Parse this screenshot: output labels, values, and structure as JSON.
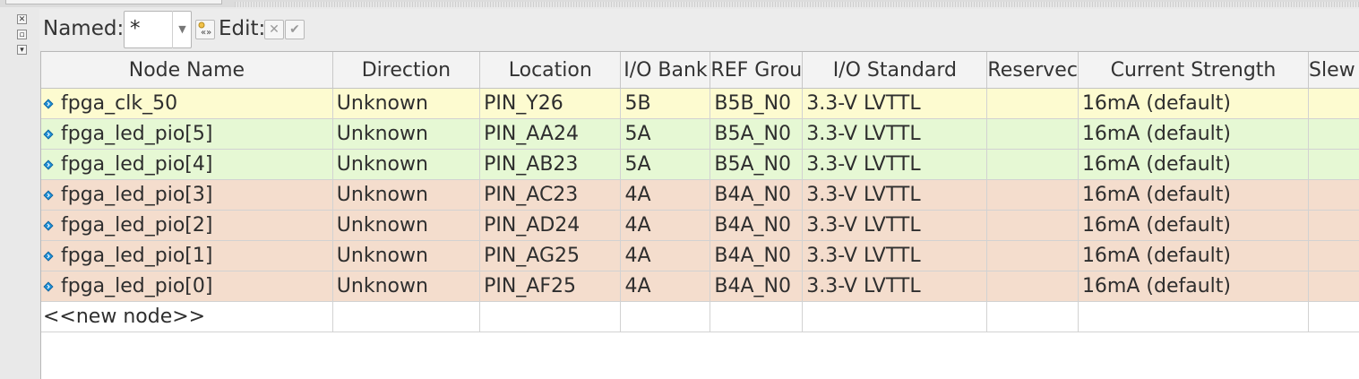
{
  "toolbar": {
    "named_label": "Named:",
    "named_value": "*",
    "edit_label": "Edit:"
  },
  "columns": [
    "Node Name",
    "Direction",
    "Location",
    "I/O Bank",
    "REF Grou",
    "I/O Standard",
    "Reservec",
    "Current Strength",
    "Slew"
  ],
  "rows": [
    {
      "node": "fpga_clk_50",
      "direction": "Unknown",
      "location": "PIN_Y26",
      "bank": "5B",
      "vref": "B5B_N0",
      "standard": "3.3-V LVTTL",
      "reserved": "",
      "strength": "16mA (default)",
      "slew": "",
      "color": "#fdfbd0"
    },
    {
      "node": "fpga_led_pio[5]",
      "direction": "Unknown",
      "location": "PIN_AA24",
      "bank": "5A",
      "vref": "B5A_N0",
      "standard": "3.3-V LVTTL",
      "reserved": "",
      "strength": "16mA (default)",
      "slew": "",
      "color": "#e6f8d4"
    },
    {
      "node": "fpga_led_pio[4]",
      "direction": "Unknown",
      "location": "PIN_AB23",
      "bank": "5A",
      "vref": "B5A_N0",
      "standard": "3.3-V LVTTL",
      "reserved": "",
      "strength": "16mA (default)",
      "slew": "",
      "color": "#e6f8d4"
    },
    {
      "node": "fpga_led_pio[3]",
      "direction": "Unknown",
      "location": "PIN_AC23",
      "bank": "4A",
      "vref": "B4A_N0",
      "standard": "3.3-V LVTTL",
      "reserved": "",
      "strength": "16mA (default)",
      "slew": "",
      "color": "#f4ddcd"
    },
    {
      "node": "fpga_led_pio[2]",
      "direction": "Unknown",
      "location": "PIN_AD24",
      "bank": "4A",
      "vref": "B4A_N0",
      "standard": "3.3-V LVTTL",
      "reserved": "",
      "strength": "16mA (default)",
      "slew": "",
      "color": "#f4ddcd"
    },
    {
      "node": "fpga_led_pio[1]",
      "direction": "Unknown",
      "location": "PIN_AG25",
      "bank": "4A",
      "vref": "B4A_N0",
      "standard": "3.3-V LVTTL",
      "reserved": "",
      "strength": "16mA (default)",
      "slew": "",
      "color": "#f4ddcd"
    },
    {
      "node": "fpga_led_pio[0]",
      "direction": "Unknown",
      "location": "PIN_AF25",
      "bank": "4A",
      "vref": "B4A_N0",
      "standard": "3.3-V LVTTL",
      "reserved": "",
      "strength": "16mA (default)",
      "slew": "",
      "color": "#f4ddcd"
    }
  ],
  "new_node_label": "<<new node>>",
  "icons": {
    "pin": "pin-node-icon",
    "clear": "close-icon",
    "apply": "checkmark-icon",
    "filter": "filter-icon"
  }
}
